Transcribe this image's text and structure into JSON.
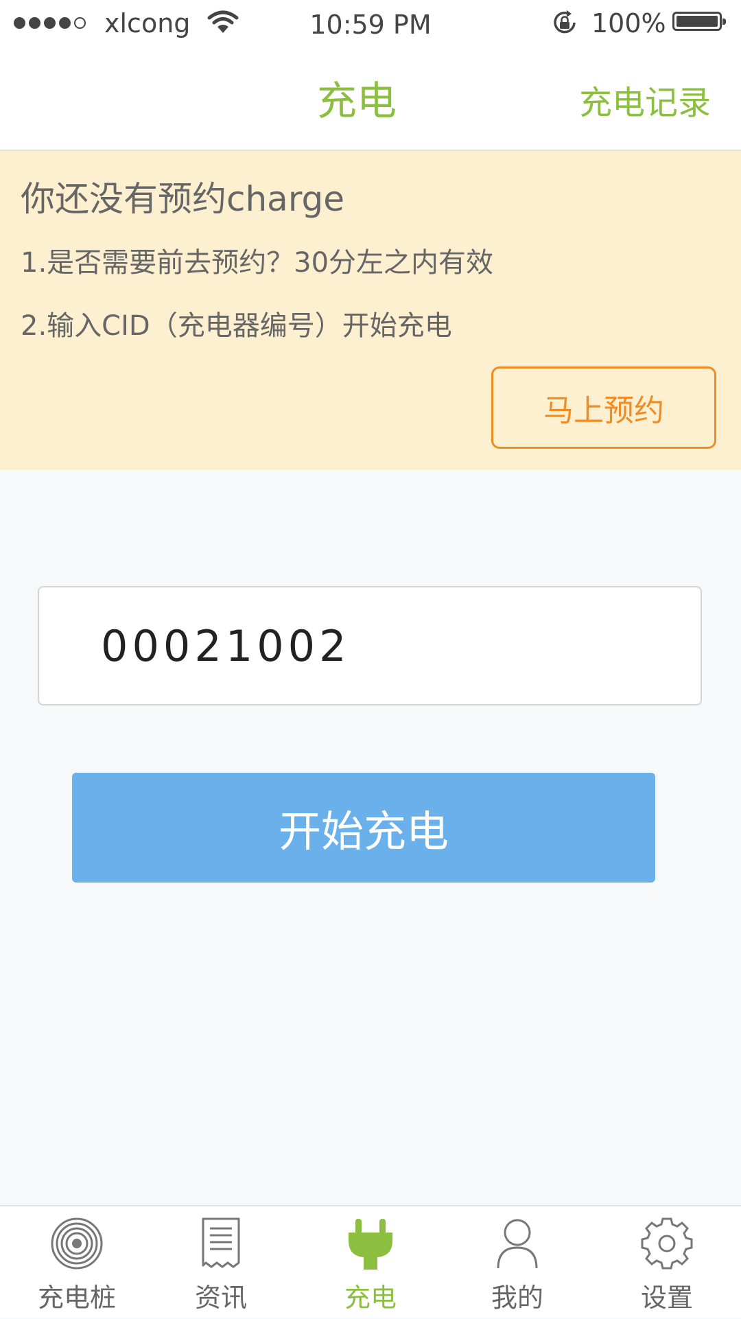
{
  "status_bar": {
    "carrier": "xlcong",
    "time": "10:59 PM",
    "battery_percent": "100%",
    "signal_bars": 4,
    "signal_total": 5,
    "icons": [
      "wifi-icon",
      "rotation-lock-icon",
      "battery-icon"
    ]
  },
  "nav": {
    "title": "充电",
    "history_link": "充电记录"
  },
  "notice": {
    "title": "你还没有预约charge",
    "line1": "1.是否需要前去预约？30分左之内有效",
    "line2": "2.输入CID（充电器编号）开始充电",
    "reserve_button": "马上预约"
  },
  "cid_input": {
    "value": "00021002"
  },
  "start_button": {
    "label": "开始充电"
  },
  "tabs": [
    {
      "label": "充电桩",
      "icon": "charging-pile-icon",
      "active": false
    },
    {
      "label": "资讯",
      "icon": "news-icon",
      "active": false
    },
    {
      "label": "充电",
      "icon": "plug-icon",
      "active": true
    },
    {
      "label": "我的",
      "icon": "user-icon",
      "active": false
    },
    {
      "label": "设置",
      "icon": "gear-icon",
      "active": false
    }
  ],
  "colors": {
    "accent_green": "#8cbf3f",
    "orange": "#ef8c24",
    "button_blue": "#6ab1ec",
    "notice_bg": "#fdf0d0"
  }
}
